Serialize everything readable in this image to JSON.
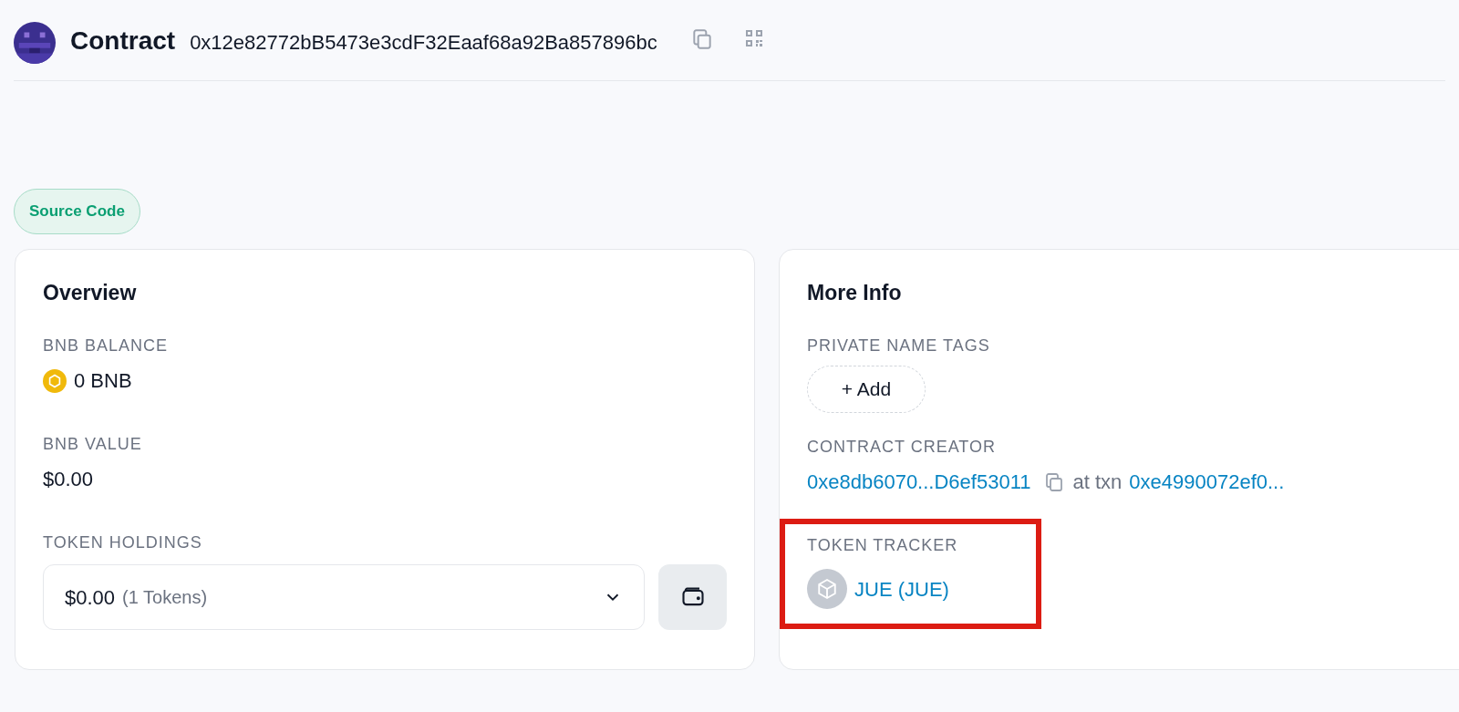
{
  "header": {
    "title": "Contract",
    "address": "0x12e82772bB5473e3cdF32Eaaf68a92Ba857896bc"
  },
  "badge": "Source Code",
  "overview": {
    "title": "Overview",
    "balance": {
      "label": "BNB BALANCE",
      "value": "0 BNB"
    },
    "value": {
      "label": "BNB VALUE",
      "value": "$0.00"
    },
    "holdings": {
      "label": "TOKEN HOLDINGS",
      "amount": "$0.00",
      "count": "(1 Tokens)"
    }
  },
  "more_info": {
    "title": "More Info",
    "name_tags": {
      "label": "PRIVATE NAME TAGS",
      "button": "+ Add"
    },
    "creator": {
      "label": "CONTRACT CREATOR",
      "address": "0xe8db6070...D6ef53011",
      "connector": "at txn",
      "txn": "0xe4990072ef0..."
    },
    "token_tracker": {
      "label": "TOKEN TRACKER",
      "token": "JUE (JUE)",
      "highlighted": true
    }
  }
}
